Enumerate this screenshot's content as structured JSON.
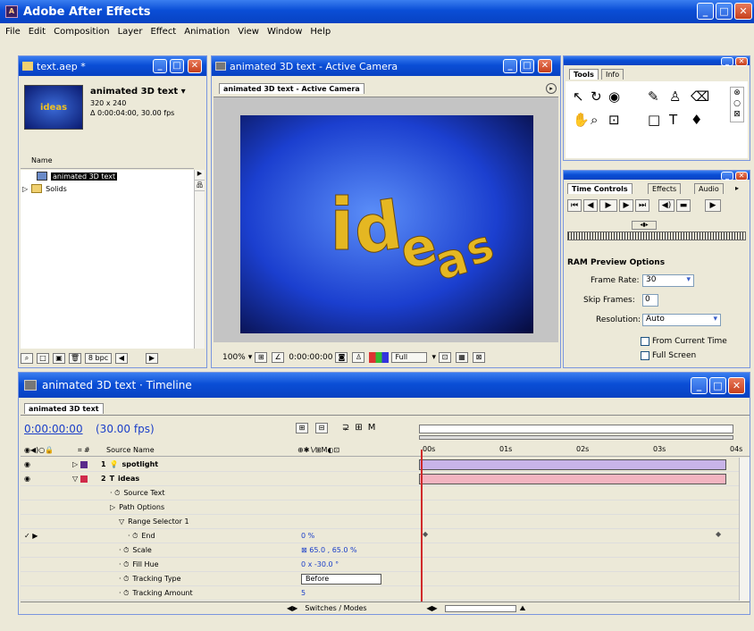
{
  "app": {
    "title": "Adobe After Effects"
  },
  "menu": [
    "File",
    "Edit",
    "Composition",
    "Layer",
    "Effect",
    "Animation",
    "View",
    "Window",
    "Help"
  ],
  "project": {
    "title": "text.aep *",
    "comp_name": "animated 3D text ▾",
    "size": "320 x 240",
    "duration": "Δ 0:00:04:00, 30.00 fps",
    "thumb_text": "ideas",
    "col_name": "Name",
    "items": [
      {
        "label": "animated 3D text",
        "selected": true
      },
      {
        "label": "Solids",
        "selected": false
      }
    ],
    "bpc": "8 bpc"
  },
  "comp": {
    "title": "animated 3D text - Active Camera",
    "tab": "animated 3D text - Active Camera",
    "word": "ideas",
    "zoom": "100%",
    "timecode": "0:00:00:00",
    "resolution": "Full"
  },
  "tools": {
    "tabs": [
      "Tools",
      "Info"
    ]
  },
  "timecontrols": {
    "tabs": [
      "Time Controls",
      "Effects",
      "Audio"
    ],
    "ram_title": "RAM Preview Options",
    "frame_rate_label": "Frame Rate:",
    "frame_rate": "30",
    "skip_label": "Skip Frames:",
    "skip": "0",
    "res_label": "Resolution:",
    "res": "Auto",
    "opt_current": "From Current Time",
    "opt_full": "Full Screen"
  },
  "timeline": {
    "title": "animated 3D text · Timeline",
    "tab": "animated 3D text",
    "timecode": "0:00:00:00",
    "fps": "(30.00 fps)",
    "source_header": "Source Name",
    "switches_header": "Switches / Modes",
    "ruler": [
      "00s",
      "01s",
      "02s",
      "03s",
      "04s"
    ],
    "rows": [
      {
        "indent": 0,
        "num": "1",
        "name": "spotlight",
        "bold": true,
        "value": "",
        "color": "#5a2a8a"
      },
      {
        "indent": 0,
        "num": "2",
        "name": "ideas",
        "bold": true,
        "value": "",
        "color": "#d02a4a"
      },
      {
        "indent": 1,
        "num": "",
        "name": "Source Text",
        "bold": false,
        "value": ""
      },
      {
        "indent": 1,
        "num": "",
        "name": "Path Options",
        "bold": false,
        "value": ""
      },
      {
        "indent": 2,
        "num": "",
        "name": "Range Selector 1",
        "bold": false,
        "value": ""
      },
      {
        "indent": 3,
        "num": "",
        "name": "End",
        "bold": false,
        "value": "0 %"
      },
      {
        "indent": 2,
        "num": "",
        "name": "Scale",
        "bold": false,
        "value": "⊠ 65.0 , 65.0 %"
      },
      {
        "indent": 2,
        "num": "",
        "name": "Fill Hue",
        "bold": false,
        "value": "0 x -30.0 °"
      },
      {
        "indent": 2,
        "num": "",
        "name": "Tracking Type",
        "bold": false,
        "value": "Before"
      },
      {
        "indent": 2,
        "num": "",
        "name": "Tracking Amount",
        "bold": false,
        "value": "5"
      }
    ]
  }
}
